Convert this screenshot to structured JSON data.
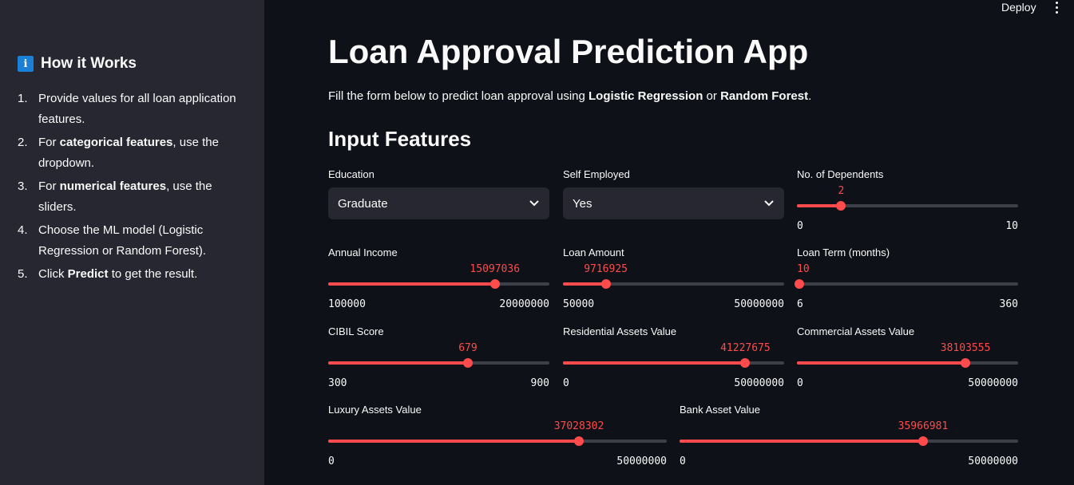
{
  "header": {
    "deploy_label": "Deploy",
    "menu_icon": "more-vertical-icon"
  },
  "sidebar": {
    "icon": "info-icon",
    "icon_glyph": "i",
    "title": "How it Works",
    "steps": [
      {
        "num": "1.",
        "pre": "Provide values for all loan application features.",
        "bold": "",
        "post": ""
      },
      {
        "num": "2.",
        "pre": "For ",
        "bold": "categorical features",
        "post": ", use the dropdown."
      },
      {
        "num": "3.",
        "pre": "For ",
        "bold": "numerical features",
        "post": ", use the sliders."
      },
      {
        "num": "4.",
        "pre": "Choose the ML model (Logistic Regression or Random Forest).",
        "bold": "",
        "post": ""
      },
      {
        "num": "5.",
        "pre": "Click ",
        "bold": "Predict",
        "post": " to get the result."
      }
    ]
  },
  "main": {
    "title": "Loan Approval Prediction App",
    "subtitle_pre": "Fill the form below to predict loan approval using ",
    "subtitle_b1": "Logistic Regression",
    "subtitle_mid": " or ",
    "subtitle_b2": "Random Forest",
    "subtitle_post": ".",
    "section_title": "Input Features"
  },
  "selects": {
    "education": {
      "label": "Education",
      "value": "Graduate"
    },
    "self_employed": {
      "label": "Self Employed",
      "value": "Yes"
    }
  },
  "sliders": {
    "dependents": {
      "label": "No. of Dependents",
      "value": "2",
      "min": "0",
      "max": "10",
      "fraction": 0.2
    },
    "income": {
      "label": "Annual Income",
      "value": "15097036",
      "min": "100000",
      "max": "20000000",
      "fraction": 0.7536
    },
    "loan_amount": {
      "label": "Loan Amount",
      "value": "9716925",
      "min": "50000",
      "max": "50000000",
      "fraction": 0.1935
    },
    "loan_term": {
      "label": "Loan Term (months)",
      "value": "10",
      "min": "6",
      "max": "360",
      "fraction": 0.0113
    },
    "cibil": {
      "label": "CIBIL Score",
      "value": "679",
      "min": "300",
      "max": "900",
      "fraction": 0.6317
    },
    "residential": {
      "label": "Residential Assets Value",
      "value": "41227675",
      "min": "0",
      "max": "50000000",
      "fraction": 0.8246
    },
    "commercial": {
      "label": "Commercial Assets Value",
      "value": "38103555",
      "min": "0",
      "max": "50000000",
      "fraction": 0.7621
    },
    "luxury": {
      "label": "Luxury Assets Value",
      "value": "37028302",
      "min": "0",
      "max": "50000000",
      "fraction": 0.7406
    },
    "bank": {
      "label": "Bank Asset Value",
      "value": "35966981",
      "min": "0",
      "max": "50000000",
      "fraction": 0.7193
    }
  },
  "colors": {
    "accent": "#ff4b4b",
    "background": "#0e1117",
    "sidebar": "#262730",
    "info": "#1c7fd6"
  }
}
